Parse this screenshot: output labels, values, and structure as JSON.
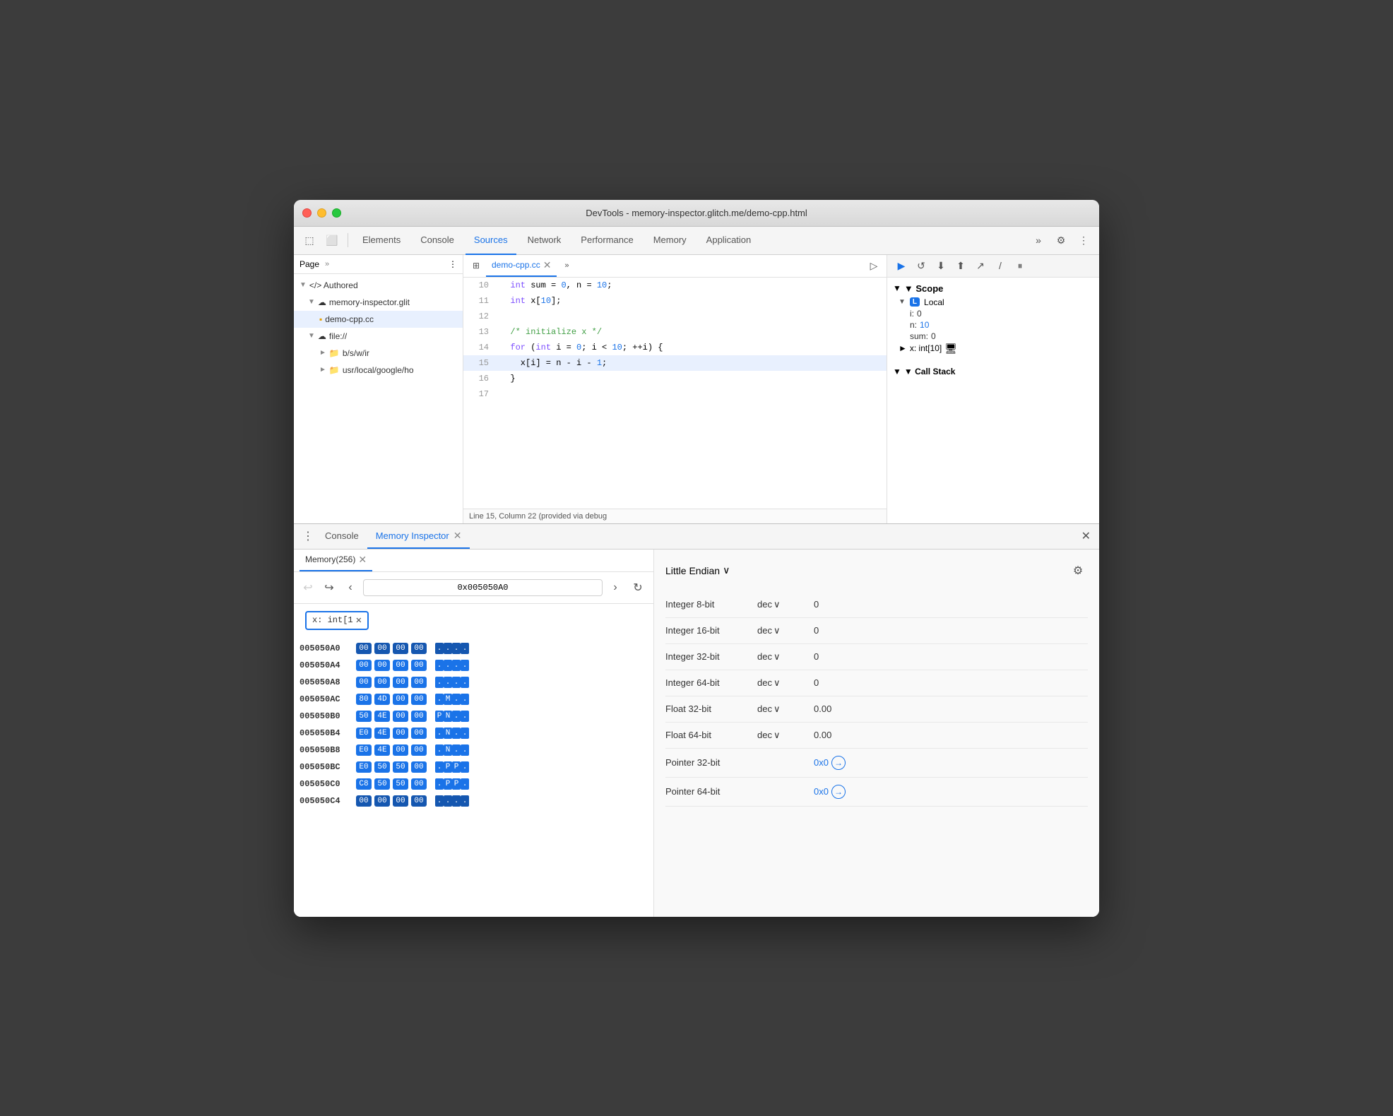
{
  "window": {
    "title": "DevTools - memory-inspector.glitch.me/demo-cpp.html"
  },
  "toolbar": {
    "tabs": [
      "Elements",
      "Console",
      "Sources",
      "Network",
      "Performance",
      "Memory",
      "Application"
    ],
    "active_tab": "Sources",
    "more_icon": "»",
    "settings_icon": "⚙",
    "dots_icon": "⋮"
  },
  "file_panel": {
    "title": "Page",
    "more": "»",
    "dots": "⋮",
    "items": [
      {
        "label": "</> Authored",
        "indent": 0,
        "arrow": "▼"
      },
      {
        "label": "memory-inspector.glit",
        "indent": 1,
        "arrow": "▼",
        "icon": "☁"
      },
      {
        "label": "demo-cpp.cc",
        "indent": 2,
        "icon": "📄",
        "selected": true
      },
      {
        "label": "file://",
        "indent": 1,
        "arrow": "▼",
        "icon": "☁"
      },
      {
        "label": "b/s/w/ir",
        "indent": 2,
        "arrow": "►",
        "icon": "📁"
      },
      {
        "label": "usr/local/google/ho",
        "indent": 2,
        "arrow": "►",
        "icon": "📁"
      }
    ]
  },
  "code_panel": {
    "tab_name": "demo-cpp.cc",
    "lines": [
      {
        "num": 10,
        "content": "  int sum = 0, n = 10;",
        "highlighted": false
      },
      {
        "num": 11,
        "content": "  int x[10];",
        "highlighted": false
      },
      {
        "num": 12,
        "content": "",
        "highlighted": false
      },
      {
        "num": 13,
        "content": "  /* initialize x */",
        "highlighted": false
      },
      {
        "num": 14,
        "content": "  for (int i = 0; i < 10; ++i) {",
        "highlighted": false
      },
      {
        "num": 15,
        "content": "    x[i] = n - i - 1;",
        "highlighted": true
      },
      {
        "num": 16,
        "content": "  }",
        "highlighted": false
      },
      {
        "num": 17,
        "content": "",
        "highlighted": false
      }
    ],
    "status": "Line 15, Column 22 (provided via debug"
  },
  "scope_panel": {
    "debug_buttons": [
      "▶",
      "↺",
      "⬇",
      "⬆",
      "↗",
      "/",
      "⏸"
    ],
    "scope_label": "▼ Scope",
    "local_label": "Local",
    "local_badge": "L",
    "scope_items": [
      {
        "key": "i:",
        "val": "0"
      },
      {
        "key": "n:",
        "val": "10"
      },
      {
        "key": "sum:",
        "val": "0"
      }
    ],
    "x_label": "▶ x: int[10]",
    "x_icon": "🖥",
    "call_stack_label": "▼ Call Stack"
  },
  "bottom_panel": {
    "tabs": [
      "Console",
      "Memory Inspector"
    ],
    "active_tab": "Memory Inspector",
    "close_icon": "✕",
    "memory_subtab": "Memory(256)",
    "address": "0x005050A0",
    "expression_tag": "x: int[1",
    "nav_back_disabled": true,
    "nav_forward_disabled": false,
    "endian": "Little Endian",
    "endian_arrow": "∨",
    "settings_icon": "⚙",
    "hex_rows": [
      {
        "addr": "005050A0",
        "is_current": true,
        "bytes": [
          "00",
          "00",
          "00",
          "00"
        ],
        "chars": [
          ".",
          ".",
          ".",
          "."
        ]
      },
      {
        "addr": "005050A4",
        "is_current": false,
        "bytes": [
          "00",
          "00",
          "00",
          "00"
        ],
        "chars": [
          ".",
          ".",
          ".",
          "."
        ]
      },
      {
        "addr": "005050A8",
        "is_current": false,
        "bytes": [
          "00",
          "00",
          "00",
          "00"
        ],
        "chars": [
          ".",
          ".",
          ".",
          "."
        ]
      },
      {
        "addr": "005050AC",
        "is_current": false,
        "bytes": [
          "80",
          "4D",
          "00",
          "00"
        ],
        "chars": [
          ".",
          "M",
          ".",
          "."
        ]
      },
      {
        "addr": "005050B0",
        "is_current": false,
        "bytes": [
          "50",
          "4E",
          "00",
          "00"
        ],
        "chars": [
          "P",
          "N",
          ".",
          "."
        ]
      },
      {
        "addr": "005050B4",
        "is_current": false,
        "bytes": [
          "E0",
          "4E",
          "00",
          "00"
        ],
        "chars": [
          ".",
          "N",
          ".",
          "."
        ]
      },
      {
        "addr": "005050B8",
        "is_current": false,
        "bytes": [
          "E0",
          "4E",
          "00",
          "00"
        ],
        "chars": [
          ".",
          "N",
          ".",
          "."
        ]
      },
      {
        "addr": "005050BC",
        "is_current": false,
        "bytes": [
          "E0",
          "50",
          "50",
          "00"
        ],
        "chars": [
          ".",
          "P",
          "P",
          "."
        ]
      },
      {
        "addr": "005050C0",
        "is_current": false,
        "bytes": [
          "C8",
          "50",
          "50",
          "00"
        ],
        "chars": [
          ".",
          "P",
          "P",
          "."
        ]
      },
      {
        "addr": "005050C4",
        "is_current": false,
        "bytes": [
          "00",
          "00",
          "00",
          "00"
        ],
        "chars": [
          ".",
          ".",
          ".",
          "."
        ]
      }
    ],
    "values": [
      {
        "type": "Integer 8-bit",
        "format": "dec",
        "value": "0"
      },
      {
        "type": "Integer 16-bit",
        "format": "dec",
        "value": "0"
      },
      {
        "type": "Integer 32-bit",
        "format": "dec",
        "value": "0"
      },
      {
        "type": "Integer 64-bit",
        "format": "dec",
        "value": "0"
      },
      {
        "type": "Float 32-bit",
        "format": "dec",
        "value": "0.00"
      },
      {
        "type": "Float 64-bit",
        "format": "dec",
        "value": "0.00"
      },
      {
        "type": "Pointer 32-bit",
        "format": "",
        "value": "0x0",
        "is_pointer": true
      },
      {
        "type": "Pointer 64-bit",
        "format": "",
        "value": "0x0",
        "is_pointer": true
      }
    ]
  }
}
